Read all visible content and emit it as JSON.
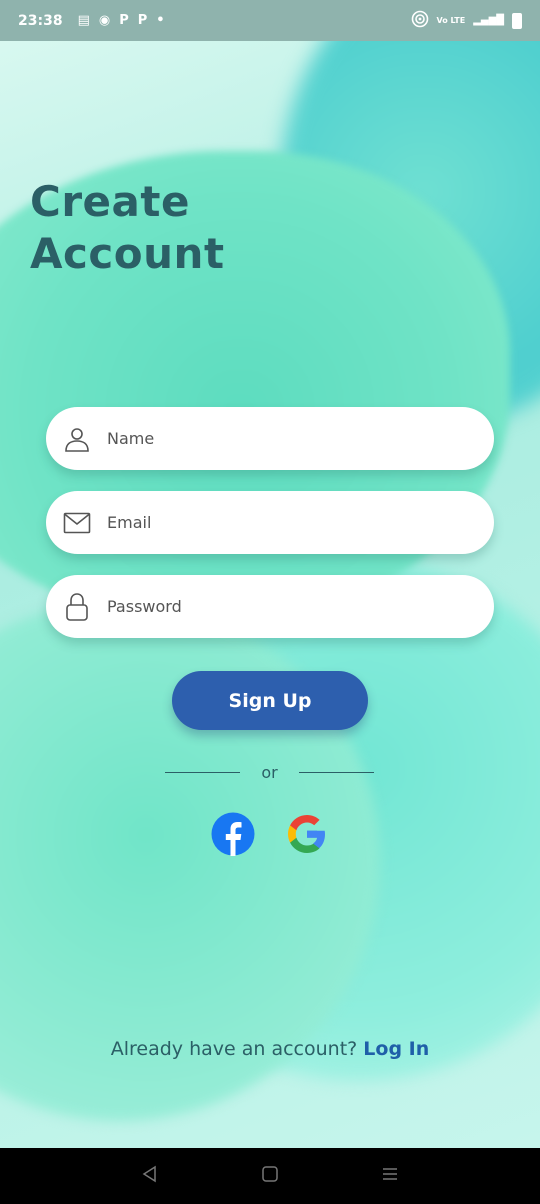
{
  "status_bar": {
    "time": "23:38",
    "notification_icons": [
      "newspaper-icon",
      "circle-app-icon",
      "p-app-icon",
      "p-app-icon",
      "dot-icon"
    ],
    "notification_glyphs": [
      "▤",
      "◉",
      "P",
      "P",
      "•"
    ],
    "right_icons": [
      "hotspot-icon",
      "volte-icon",
      "signal-icon",
      "battery-charging-icon"
    ],
    "volte_text": "Vo LTE",
    "signal_glyph": "▂▄▆█"
  },
  "page": {
    "title_line1": "Create",
    "title_line2": "Account"
  },
  "form": {
    "name_placeholder": "Name",
    "email_placeholder": "Email",
    "password_placeholder": "Password",
    "signup_label": "Sign Up"
  },
  "divider": {
    "text": "or"
  },
  "social": {
    "facebook": "facebook-icon",
    "google": "google-icon"
  },
  "footer": {
    "prompt": "Already have an account?",
    "login_label": "Log In"
  },
  "nav": {
    "back": "back-icon",
    "home": "home-icon",
    "recents": "recents-icon"
  },
  "colors": {
    "title": "#2b5f66",
    "button": "#2d5fae",
    "link": "#1f5fa8",
    "status_bar": "#8fb3ad"
  }
}
